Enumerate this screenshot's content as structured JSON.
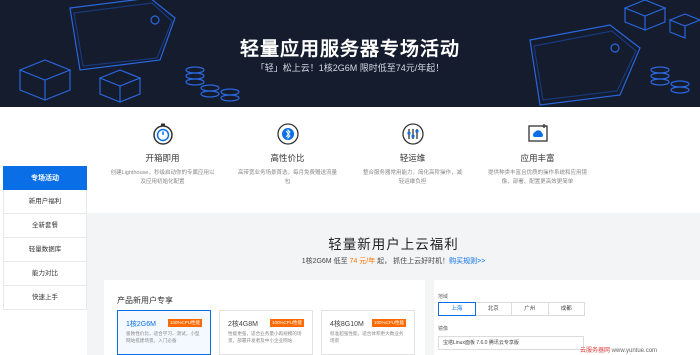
{
  "hero": {
    "title": "轻量应用服务器专场活动",
    "subtitle": "「轻」松上云！1核2G6M 限时低至74元/年起！"
  },
  "features": [
    {
      "icon": "stopwatch-icon",
      "title": "开箱即用",
      "desc": "创建Lighthouse，秒级启动你的专属应用以及应用初始化配置"
    },
    {
      "icon": "bluetooth-shield-icon",
      "title": "高性价比",
      "desc": "高带宽业务场景首选，每月免费赠送流量包"
    },
    {
      "icon": "tools-icon",
      "title": "轻运维",
      "desc": "整合服务器常用能力，简化高阶操作，减轻运维负担"
    },
    {
      "icon": "cloud-app-icon",
      "title": "应用丰富",
      "desc": "提供种类丰富且优质的操作系统和应用镜像，部署、配置更高效更简单"
    }
  ],
  "sidebar": {
    "items": [
      {
        "label": "专场活动",
        "active": true
      },
      {
        "label": "新用户福利"
      },
      {
        "label": "全新套餐"
      },
      {
        "label": "轻量数据库"
      },
      {
        "label": "能力对比"
      },
      {
        "label": "快速上手"
      }
    ]
  },
  "promo": {
    "title": "轻量新用户上云福利",
    "sub_prefix": "1核2G6M 低至 ",
    "sub_price": "74 元/年",
    "sub_suffix": " 起， 抓住上云好时机！",
    "sub_link": "购买规则>>"
  },
  "products": {
    "title": "产品新用户专享",
    "plans": [
      {
        "name": "1核2G6M",
        "badge": "100%CPU性能",
        "desc": "极致性价比，适合学习、测试，小型网站搭建场景，入门必备",
        "selected": true
      },
      {
        "name": "2核4G8M",
        "badge": "100%CPU性能",
        "desc": "性能更强，适合业务量小再规模的场景，部署开发者及中小企业网站"
      },
      {
        "name": "4核8G10M",
        "badge": "100%CPU性能",
        "desc": "标准超强性能，适合体积更大数业务场景"
      }
    ]
  },
  "region": {
    "label": "地域",
    "options": [
      {
        "label": "上海",
        "selected": true
      },
      {
        "label": "北京"
      },
      {
        "label": "广州"
      },
      {
        "label": "成都"
      }
    ],
    "image_label": "镜像",
    "image_value": "宝塔Linux面板 7.6.0 腾讯云专享版"
  },
  "watermark": {
    "cn": "云服务器网 ",
    "url": "www.yuntue.com"
  },
  "colors": {
    "accent": "#0a6fe6",
    "badge": "#ff6a00",
    "hero_bg": "#141c2d"
  }
}
